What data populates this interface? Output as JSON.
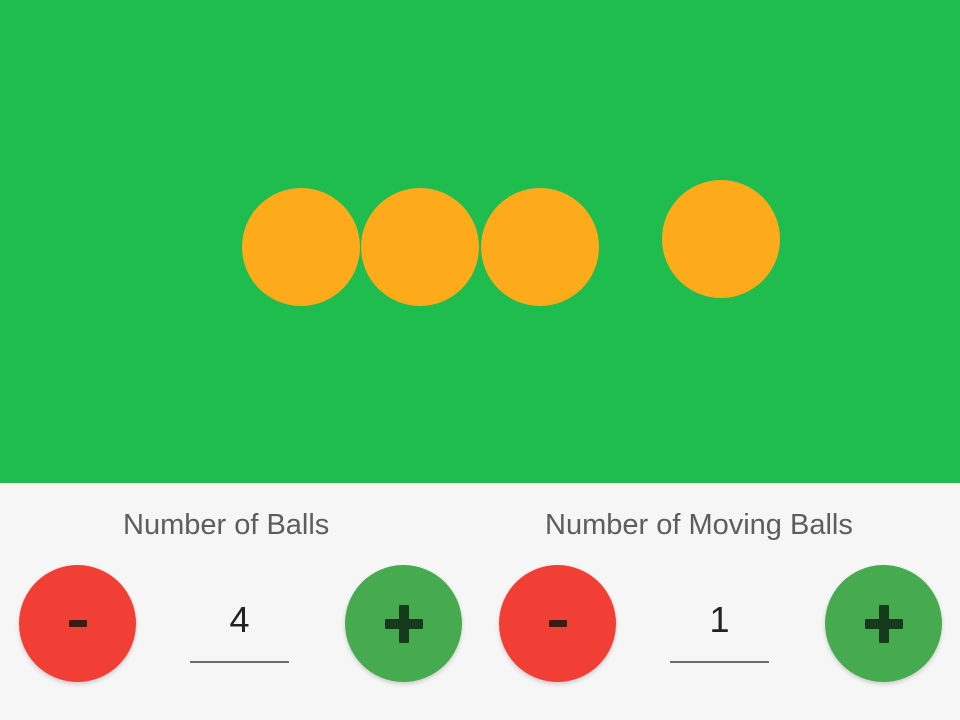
{
  "colors": {
    "stage_background": "#1fbd4d",
    "ball": "#fdab1b",
    "minus_button": "#f13f36",
    "plus_button": "#46ab4f",
    "panel_background": "#f6f6f6"
  },
  "stage": {
    "balls_shown": 4
  },
  "controls": {
    "balls": {
      "label": "Number of Balls",
      "value": "4",
      "decrement_icon": "minus-icon",
      "increment_icon": "plus-icon"
    },
    "moving_balls": {
      "label": "Number of Moving Balls",
      "value": "1",
      "decrement_icon": "minus-icon",
      "increment_icon": "plus-icon"
    }
  }
}
